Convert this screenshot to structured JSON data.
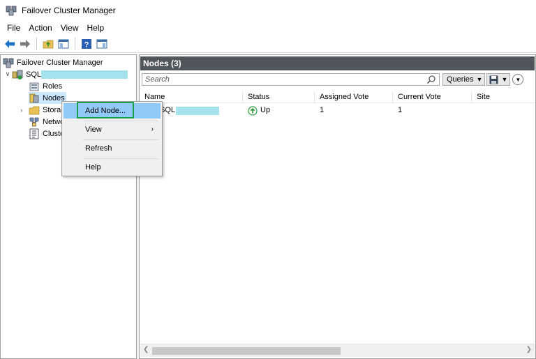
{
  "window": {
    "title": "Failover Cluster Manager"
  },
  "menu": [
    "File",
    "Action",
    "View",
    "Help"
  ],
  "toolbar": {
    "icons": [
      "back-arrow-icon",
      "forward-arrow-icon",
      "folder-up-icon",
      "console-tree-icon",
      "help-icon",
      "action-pane-icon"
    ]
  },
  "tree": {
    "root": "Failover Cluster Manager",
    "cluster": "SQL",
    "roles": "Roles",
    "nodes": "Nodes",
    "storage": "Storag",
    "networks": "Netwo",
    "cluster_events": "Cluste"
  },
  "panel": {
    "title": "Nodes (3)",
    "search_placeholder": "Search",
    "queries_label": "Queries"
  },
  "grid": {
    "columns": [
      "Name",
      "Status",
      "Assigned Vote",
      "Current Vote",
      "Site"
    ],
    "rows": [
      {
        "name": "SQL",
        "status": "Up",
        "assigned_vote": "1",
        "current_vote": "1",
        "site": ""
      }
    ]
  },
  "context_menu": {
    "items": [
      "Add Node...",
      "View",
      "Refresh",
      "Help"
    ],
    "highlighted": "Add Node..."
  },
  "colors": {
    "header_bg": "#50565b",
    "highlight": "#91c9f7",
    "annotation_box": "#1e9e4a",
    "redaction": "#a6e1ee"
  }
}
